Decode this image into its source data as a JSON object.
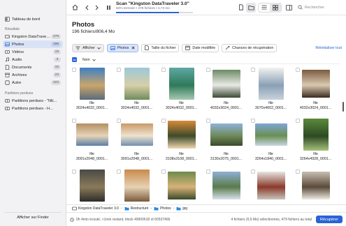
{
  "sidebar": {
    "dashboard_label": "Tableau de bord",
    "results_heading": "Résultats",
    "items": [
      {
        "label": "Kingston DataTraveler 3.0",
        "count": "479",
        "icon": "drive-icon"
      },
      {
        "label": "Photos",
        "count": "196",
        "icon": "photo-icon",
        "active": true
      },
      {
        "label": "Vidéos",
        "count": "18",
        "icon": "video-icon"
      },
      {
        "label": "Audio",
        "count": "3",
        "icon": "audio-icon"
      },
      {
        "label": "Documents",
        "count": "16",
        "icon": "document-icon"
      },
      {
        "label": "Archives",
        "count": "23",
        "icon": "archive-icon"
      },
      {
        "label": "Autre",
        "count": "223",
        "icon": "other-icon"
      }
    ],
    "lost_heading": "Partitions perdues",
    "lost_items": [
      {
        "label": "Partitions perdues - \"NE..."
      },
      {
        "label": "Partitions perdues - H..."
      }
    ],
    "show_finder_label": "Afficher sur Finder"
  },
  "toolbar": {
    "scan_title": "Scan \"Kingston DataTraveler 3.0\"",
    "scan_subtitle": "82% terminé • 479 fichiers / 4,74 Go",
    "progress_fraction": 0.82,
    "search_placeholder": "Rechercher"
  },
  "page": {
    "title": "Photos",
    "subtitle": "196 fichiers/806,4 Mo"
  },
  "filters": {
    "show_label": "Afficher",
    "active_filter": "Photos",
    "size_label": "Taille du fichier",
    "date_label": "Date modifiée",
    "chances_label": "Chances de récupération",
    "reset_label": "Réinitialiser tout"
  },
  "columns": {
    "name_label": "Nom"
  },
  "files": [
    {
      "name": "file",
      "dims": "3024x4032_0001...",
      "orient": "portrait",
      "colors": [
        "#3d7fc4",
        "#caa56b",
        "#5a6b7a"
      ]
    },
    {
      "name": "file",
      "dims": "3024x4032_0001...",
      "orient": "portrait",
      "colors": [
        "#9cc7d8",
        "#d8cfa8",
        "#6f8c5a"
      ]
    },
    {
      "name": "file",
      "dims": "3024x4032_0001...",
      "orient": "portrait",
      "colors": [
        "#5fa7a3",
        "#2f7a5a",
        "#a8c9b2"
      ]
    },
    {
      "name": "file",
      "dims": "4032x3024_0001...",
      "orient": "square",
      "colors": [
        "#6b8a62",
        "#e9e9e6",
        "#3b4a34"
      ]
    },
    {
      "name": "file",
      "dims": "3070x4602_0001...",
      "orient": "portrait",
      "colors": [
        "#f2f2f0",
        "#8aa0b6",
        "#c9d3db"
      ]
    },
    {
      "name": "file",
      "dims": "4032x3024_0001...",
      "orient": "square",
      "colors": [
        "#7a5a3e",
        "#d9c9b0",
        "#3b2b1e"
      ]
    },
    {
      "name": "file",
      "dims": "3091x2048_0001...",
      "orient": "landscape",
      "colors": [
        "#b58f62",
        "#e6d4b8",
        "#5a7fa6"
      ]
    },
    {
      "name": "file",
      "dims": "3091x2048_0001...",
      "orient": "landscape",
      "colors": [
        "#c99a6a",
        "#efe2cf",
        "#6f8faf"
      ]
    },
    {
      "name": "file",
      "dims": "3108x3108_0001...",
      "orient": "square",
      "colors": [
        "#d78a3a",
        "#3e4a2a",
        "#f2d7b0"
      ]
    },
    {
      "name": "file",
      "dims": "3130x2075_0001...",
      "orient": "landscape",
      "colors": [
        "#8fb3d9",
        "#6f8a5a",
        "#3b4a2b"
      ]
    },
    {
      "name": "file",
      "dims": "3264x1840_0001...",
      "orient": "landscape",
      "colors": [
        "#7ea7d6",
        "#6a8f52",
        "#c8d6e4"
      ]
    },
    {
      "name": "file",
      "dims": "3264x4928_0001...",
      "orient": "portrait",
      "colors": [
        "#5b8a3c",
        "#2d4a22",
        "#a6c27c"
      ]
    },
    {
      "name": "",
      "dims": "",
      "orient": "portrait",
      "colors": [
        "#4a4a45",
        "#8a7a5a",
        "#2c2c28"
      ]
    },
    {
      "name": "",
      "dims": "",
      "orient": "portrait",
      "colors": [
        "#c98a4a",
        "#e6d2b4",
        "#7a5a3a"
      ]
    },
    {
      "name": "",
      "dims": "",
      "orient": "square",
      "colors": [
        "#6e8a4a",
        "#d7b27a",
        "#3a4a2a"
      ]
    },
    {
      "name": "",
      "dims": "",
      "orient": "square",
      "colors": [
        "#8fb0d6",
        "#5a7a4a",
        "#d9e3ec"
      ]
    },
    {
      "name": "",
      "dims": "",
      "orient": "square",
      "colors": [
        "#e8e6e2",
        "#8a3a2a",
        "#c9c4bc"
      ]
    },
    {
      "name": "",
      "dims": "",
      "orient": "square",
      "colors": [
        "#c9c0b2",
        "#5a4a3a",
        "#efeae2"
      ]
    }
  ],
  "pathbar": {
    "crumbs": [
      "Kingston DataTraveler 3.0",
      "Restructuré",
      "Photos",
      "jpg"
    ]
  },
  "status": {
    "left": "0h 4min écoulé, <1min restant, block 49900618 of 60537466",
    "right": "4 fichiers (6,5 Mo) sélectionnés, 479 fichiers au total",
    "recover_label": "Récupérer"
  },
  "colors": {
    "accent": "#2a64d6",
    "sidebar_bg": "#f2f2f4",
    "selected_bg": "#d9e3f5"
  }
}
